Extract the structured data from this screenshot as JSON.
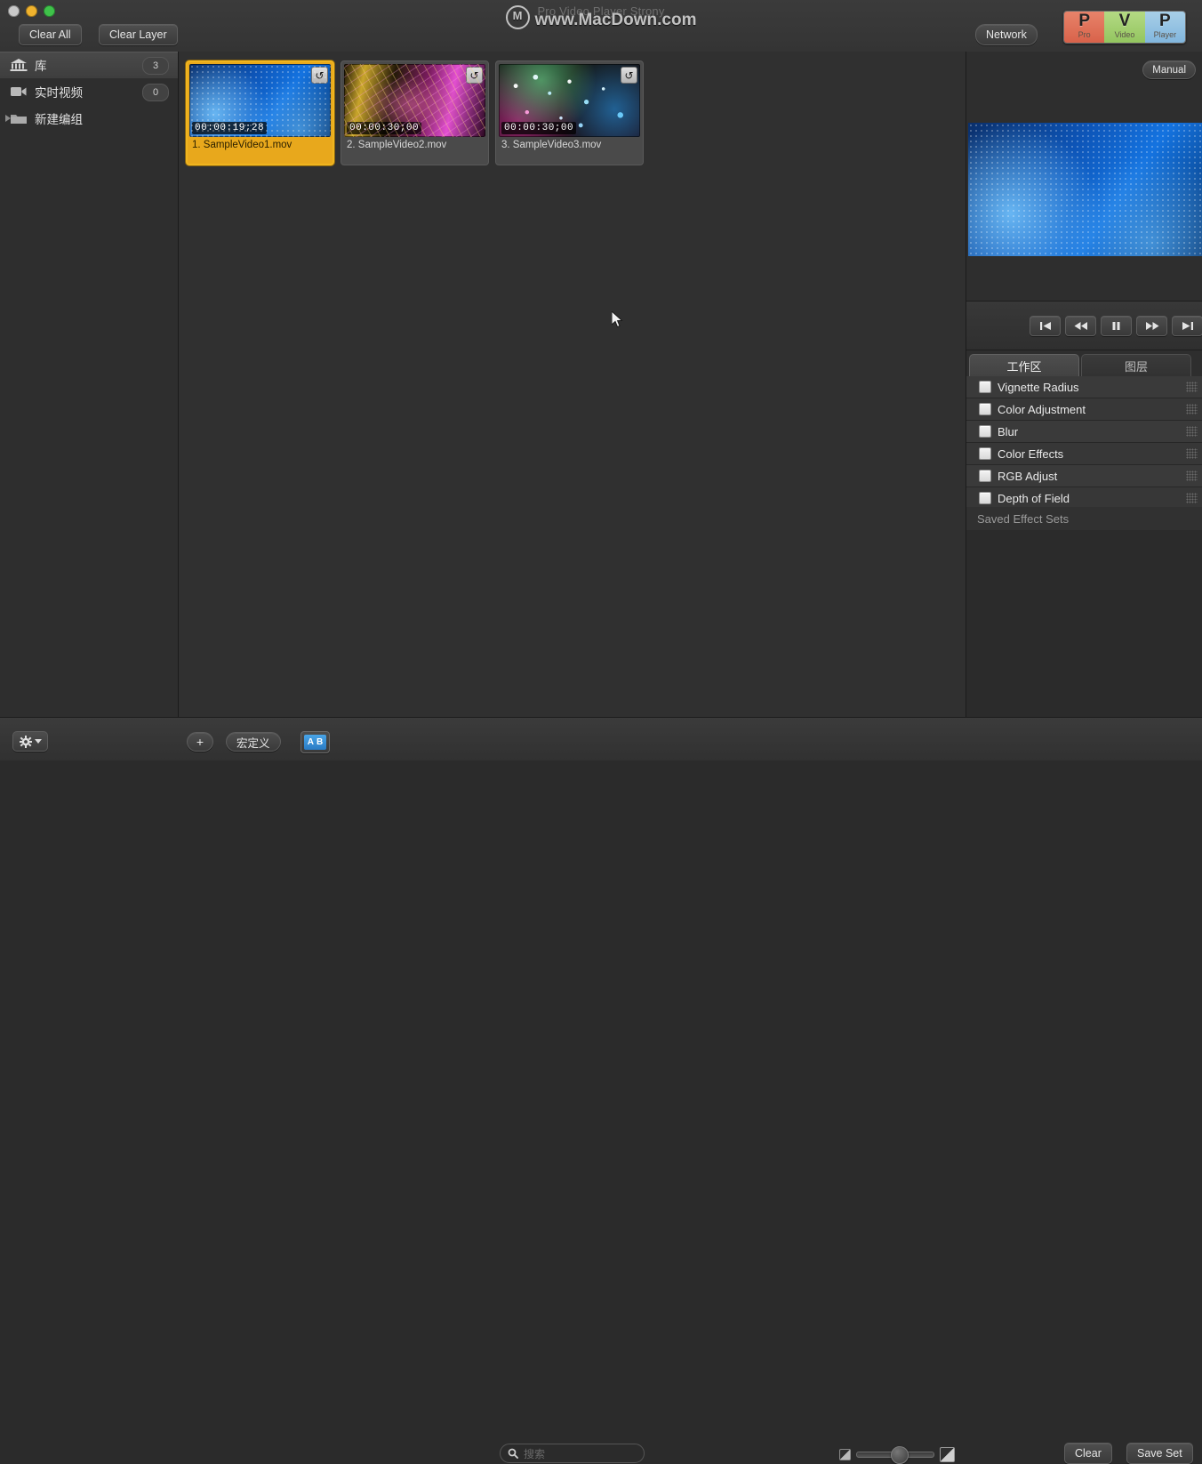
{
  "window": {
    "title": "Pro Video Player Strony",
    "watermark": "www.MacDown.com",
    "watermark_logo": "macdown-circle-logo"
  },
  "titlebar": {
    "clear_all_label": "Clear All",
    "clear_layer_label": "Clear Layer",
    "network_label": "Network",
    "logo": {
      "segments": [
        {
          "letter": "P",
          "word": "Pro",
          "color": "#dd6b4f"
        },
        {
          "letter": "V",
          "word": "Video",
          "color": "#9ec96a"
        },
        {
          "letter": "P",
          "word": "Player",
          "color": "#8fbede"
        }
      ]
    }
  },
  "sidebar": {
    "items": [
      {
        "label": "库",
        "badge": "3",
        "icon": "library-icon",
        "selected": true,
        "disclosure": false
      },
      {
        "label": "实时视频",
        "badge": "0",
        "icon": "video-camera-icon",
        "selected": false,
        "disclosure": false
      },
      {
        "label": "新建编组",
        "badge": "",
        "icon": "folder-icon",
        "selected": false,
        "disclosure": true
      }
    ]
  },
  "browser": {
    "clips": [
      {
        "index": "1",
        "name": "1. SampleVideo1.mov",
        "timecode": "00:00:19;28",
        "selected": true,
        "art": "art-blue",
        "badge_icon": "loop-icon"
      },
      {
        "index": "2",
        "name": "2. SampleVideo2.mov",
        "timecode": "00:00:30;00",
        "selected": false,
        "art": "art-mesh",
        "badge_icon": "loop-icon"
      },
      {
        "index": "3",
        "name": "3. SampleVideo3.mov",
        "timecode": "00:00:30;00",
        "selected": false,
        "art": "art-bokeh",
        "badge_icon": "loop-icon"
      }
    ]
  },
  "right_panel": {
    "manual_label": "Manual",
    "preview_art": "art-blue",
    "transport": [
      {
        "name": "skip-to-start-button",
        "icon": "skip-back-icon"
      },
      {
        "name": "rewind-button",
        "icon": "rewind-icon"
      },
      {
        "name": "pause-button",
        "icon": "pause-icon"
      },
      {
        "name": "fast-forward-button",
        "icon": "fast-forward-icon"
      },
      {
        "name": "skip-to-end-button",
        "icon": "skip-forward-icon"
      }
    ],
    "tabs": [
      {
        "label": "工作区",
        "active": true
      },
      {
        "label": "图层",
        "active": false
      }
    ],
    "effects": [
      {
        "label": "Vignette Radius",
        "checked": false
      },
      {
        "label": "Color Adjustment",
        "checked": false
      },
      {
        "label": "Blur",
        "checked": false
      },
      {
        "label": "Color Effects",
        "checked": false
      },
      {
        "label": "RGB Adjust",
        "checked": false
      },
      {
        "label": "Depth of Field",
        "checked": false
      }
    ],
    "saved_sets_label": "Saved Effect Sets"
  },
  "bottombar": {
    "gear_label": "gear-icon",
    "add_label": "+",
    "macro_label": "宏定义",
    "ab_label_a": "A",
    "ab_label_b": "B",
    "search_placeholder": "搜索",
    "clear_label": "Clear",
    "save_set_label": "Save Set"
  },
  "colors": {
    "selection": "#e8a81c",
    "panel_bg": "#2e2e2e",
    "browser_bg": "#303030",
    "text": "#e2e2e2"
  }
}
